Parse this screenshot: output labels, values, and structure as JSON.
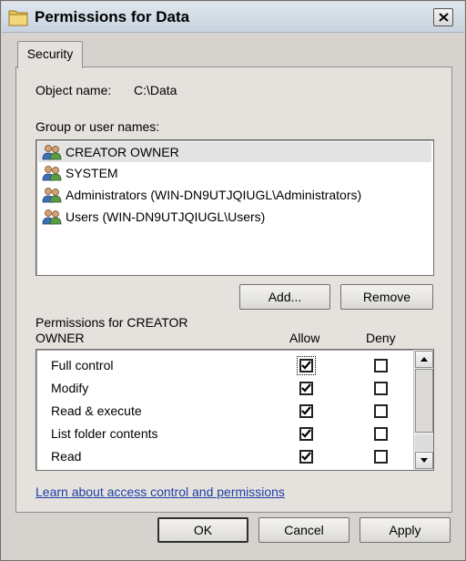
{
  "window": {
    "title": "Permissions for Data",
    "icon": "folder-icon",
    "close_icon": "close-x-icon"
  },
  "tabs": [
    {
      "label": "Security",
      "active": true
    }
  ],
  "object_name": {
    "label": "Object name:",
    "value": "C:\\Data"
  },
  "users": {
    "label": "Group or user names:",
    "icon": "users-group-icon",
    "items": [
      {
        "label": "CREATOR OWNER",
        "selected": true
      },
      {
        "label": "SYSTEM",
        "selected": false
      },
      {
        "label": "Administrators (WIN-DN9UTJQIUGL\\Administrators)",
        "selected": false
      },
      {
        "label": "Users (WIN-DN9UTJQIUGL\\Users)",
        "selected": false
      }
    ],
    "add_button": "Add...",
    "remove_button": "Remove"
  },
  "permissions": {
    "title_line1": "Permissions for CREATOR",
    "title_line2": "OWNER",
    "allow_header": "Allow",
    "deny_header": "Deny",
    "items": [
      {
        "label": "Full control",
        "allow": true,
        "deny": false
      },
      {
        "label": "Modify",
        "allow": true,
        "deny": false
      },
      {
        "label": "Read & execute",
        "allow": true,
        "deny": false
      },
      {
        "label": "List folder contents",
        "allow": true,
        "deny": false
      },
      {
        "label": "Read",
        "allow": true,
        "deny": false
      }
    ]
  },
  "help_link": "Learn about access control and permissions",
  "footer": {
    "ok": "OK",
    "cancel": "Cancel",
    "apply": "Apply"
  },
  "colors": {
    "dialog_bg": "#d6d3ce",
    "panel_bg": "#e5e2dd",
    "link": "#1f3fa6"
  }
}
